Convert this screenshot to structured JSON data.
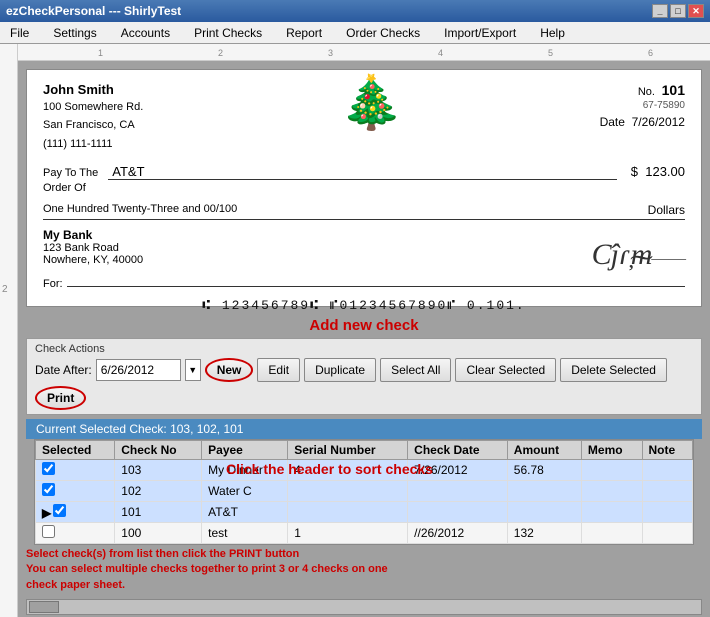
{
  "window": {
    "title": "ezCheckPersonal --- ShirlyTest",
    "title_bar_buttons": [
      "minimize",
      "maximize",
      "close"
    ]
  },
  "menu": {
    "items": [
      "File",
      "Settings",
      "Accounts",
      "Print Checks",
      "Report",
      "Order Checks",
      "Import/Export",
      "Help"
    ]
  },
  "check": {
    "name": "John Smith",
    "address_line1": "100 Somewhere Rd.",
    "address_line2": "San Francisco, CA",
    "address_line3": "(111) 111-1111",
    "no_label": "No.",
    "no_value": "101",
    "routing_fractional": "67-75890",
    "date_label": "Date",
    "date_value": "7/26/2012",
    "pay_to_label": "Pay To The",
    "order_of_label": "Order Of",
    "payee": "AT&T",
    "amount_symbol": "$",
    "amount_value": "123.00",
    "dollars_label": "Dollars",
    "words": "One Hundred Twenty-Three and 00/100",
    "bank_name": "My Bank",
    "bank_address1": "123 Bank Road",
    "bank_address2": "Nowhere, KY, 40000",
    "for_label": "For:",
    "micr": ": 123456789: \":01234567890\" 0.101."
  },
  "annotation_add": "Add new check",
  "check_actions": {
    "title": "Check Actions",
    "date_after_label": "Date After:",
    "date_after_value": "6/26/2012",
    "buttons": {
      "new": "New",
      "edit": "Edit",
      "duplicate": "Duplicate",
      "select_all": "Select All",
      "clear_selected": "Clear Selected",
      "delete_selected": "Delete Selected",
      "print": "Print"
    }
  },
  "current_selected": {
    "label": "Current Selected Check: 103, 102, 101"
  },
  "table": {
    "headers": [
      "Selected",
      "Check No",
      "Payee",
      "Serial Number",
      "Check Date",
      "Amount",
      "Memo",
      "Note"
    ],
    "rows": [
      {
        "selected": true,
        "check_no": "103",
        "payee": "My Dinner",
        "serial": "4",
        "date": "7/26/2012",
        "amount": "56.78",
        "memo": "",
        "note": "",
        "arrow": false
      },
      {
        "selected": true,
        "check_no": "102",
        "payee": "Water C",
        "serial": "",
        "date": "",
        "amount": "",
        "memo": "",
        "note": "",
        "arrow": false
      },
      {
        "selected": true,
        "check_no": "101",
        "payee": "AT&T",
        "serial": "",
        "date": "",
        "amount": "",
        "memo": "",
        "note": "",
        "arrow": true
      },
      {
        "selected": false,
        "check_no": "100",
        "payee": "test",
        "serial": "1",
        "date": "//26/2012",
        "amount": "132",
        "memo": "",
        "note": "",
        "arrow": false
      }
    ]
  },
  "sort_annotation": "Click the header to sort checks",
  "print_note_line1": "Select check(s) from list then click the PRINT button",
  "print_note_line2": "You can select multiple checks together to print 3 or 4 checks on one",
  "print_note_line3": "check paper sheet."
}
